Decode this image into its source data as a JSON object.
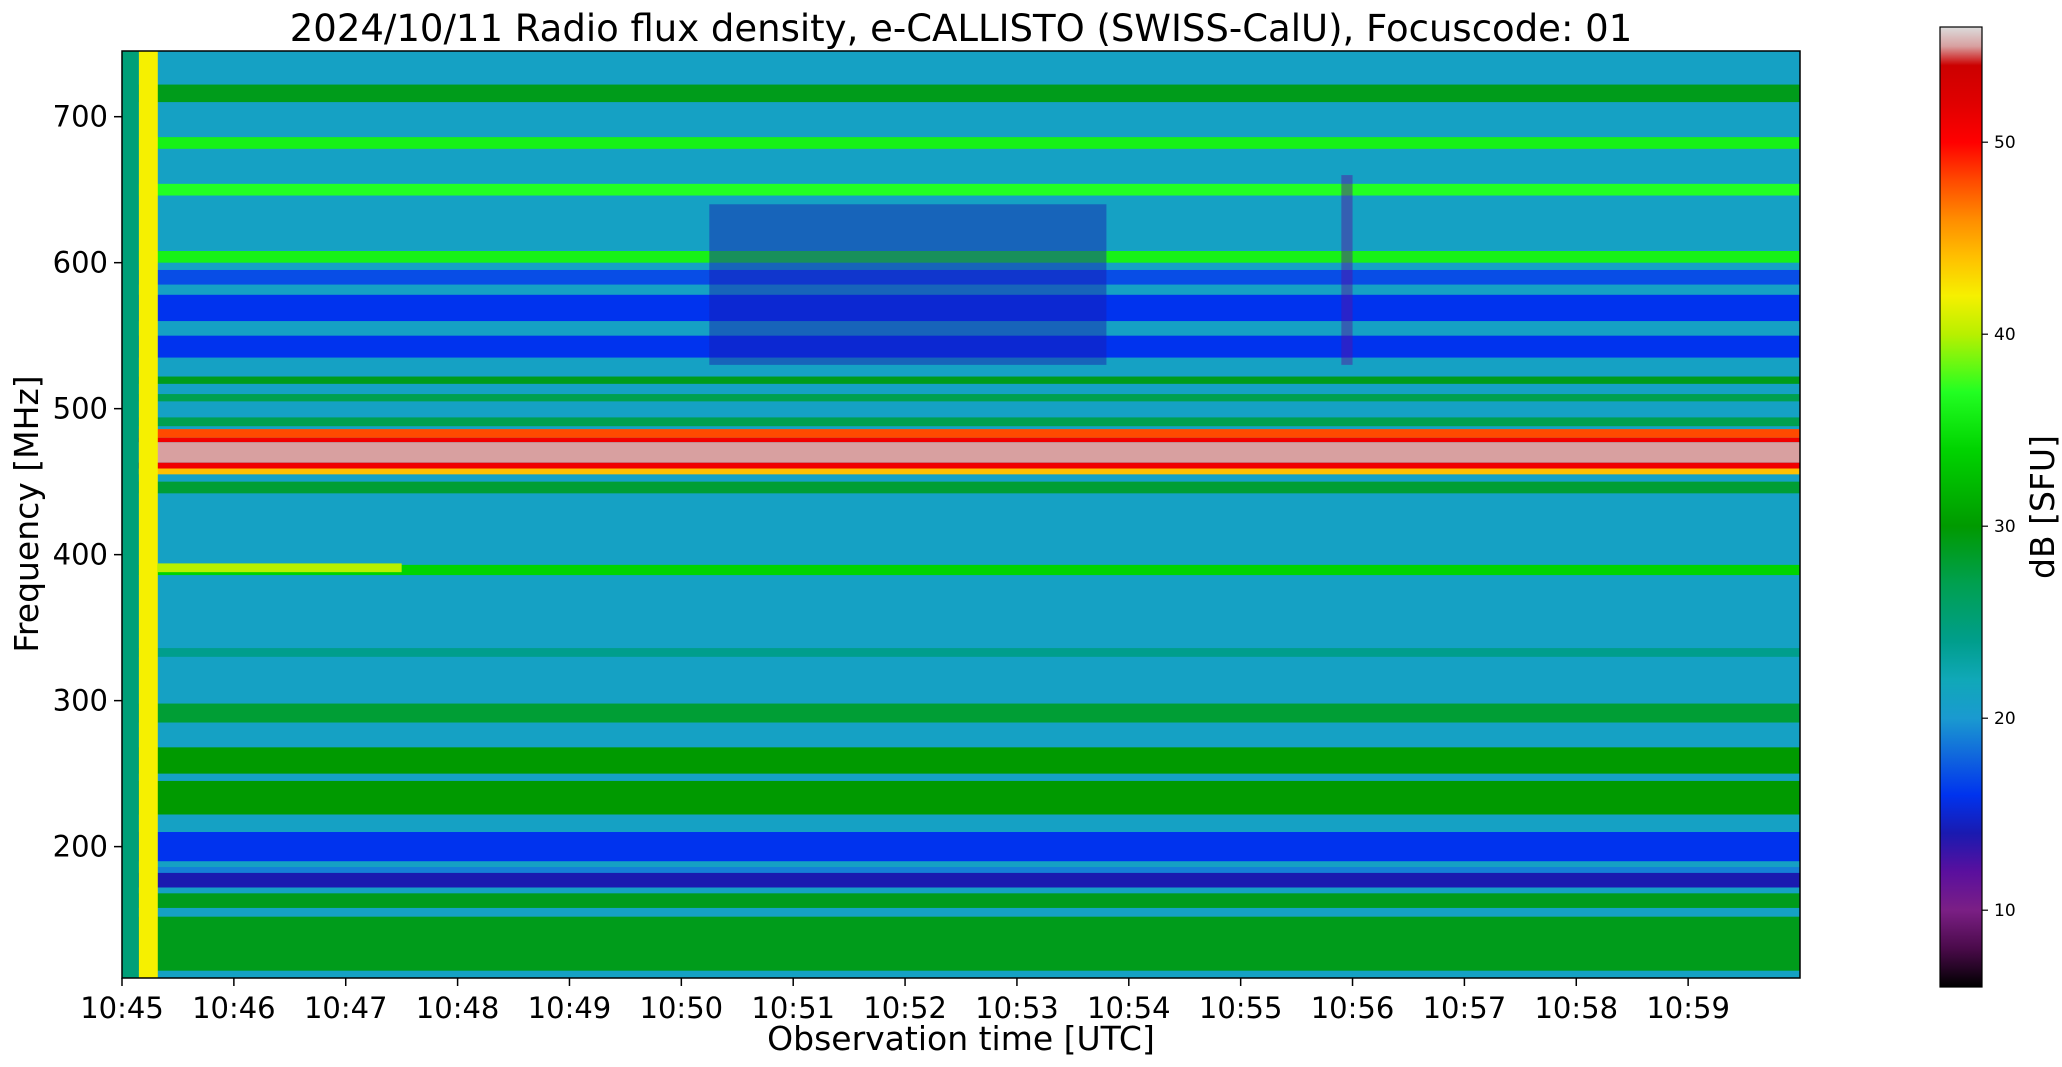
{
  "chart_data": {
    "type": "heatmap",
    "title": "2024/10/11  Radio flux density, e-CALLISTO (SWISS-CalU), Focuscode: 01",
    "xlabel": "Observation time [UTC]",
    "ylabel": "Frequency [MHz]",
    "x_ticks": [
      "10:45",
      "10:46",
      "10:47",
      "10:48",
      "10:49",
      "10:50",
      "10:51",
      "10:52",
      "10:53",
      "10:54",
      "10:55",
      "10:56",
      "10:57",
      "10:58",
      "10:59"
    ],
    "x_range_minutes": [
      0,
      15
    ],
    "y_ticks": [
      200,
      300,
      400,
      500,
      600,
      700
    ],
    "ylim": [
      110,
      745
    ],
    "colorbar": {
      "label": "dB [SFU]",
      "ticks": [
        10,
        20,
        30,
        40,
        50
      ],
      "range": [
        6,
        56
      ],
      "stops": [
        {
          "v": 6,
          "c": "#000000"
        },
        {
          "v": 8,
          "c": "#4a0a4a"
        },
        {
          "v": 10,
          "c": "#7b1f85"
        },
        {
          "v": 12,
          "c": "#5a0f9e"
        },
        {
          "v": 14,
          "c": "#1a1ab0"
        },
        {
          "v": 16,
          "c": "#0033ee"
        },
        {
          "v": 18,
          "c": "#1066dd"
        },
        {
          "v": 20,
          "c": "#1a9ad0"
        },
        {
          "v": 22,
          "c": "#10a8b8"
        },
        {
          "v": 24,
          "c": "#009e8c"
        },
        {
          "v": 27,
          "c": "#00a050"
        },
        {
          "v": 30,
          "c": "#009a00"
        },
        {
          "v": 34,
          "c": "#00d400"
        },
        {
          "v": 37,
          "c": "#22ff22"
        },
        {
          "v": 40,
          "c": "#b8f000"
        },
        {
          "v": 42,
          "c": "#f6f000"
        },
        {
          "v": 44,
          "c": "#ffc000"
        },
        {
          "v": 46,
          "c": "#ff8c00"
        },
        {
          "v": 48,
          "c": "#ff4a00"
        },
        {
          "v": 50,
          "c": "#ff0000"
        },
        {
          "v": 52,
          "c": "#e00000"
        },
        {
          "v": 54,
          "c": "#cc0000"
        },
        {
          "v": 55,
          "c": "#d8a0a0"
        },
        {
          "v": 56,
          "c": "#dcdcdc"
        }
      ]
    },
    "background_db": 21,
    "bands": [
      {
        "f_lo": 710,
        "f_hi": 722,
        "db": 29
      },
      {
        "f_lo": 678,
        "f_hi": 686,
        "db": 36
      },
      {
        "f_lo": 646,
        "f_hi": 654,
        "db": 37
      },
      {
        "f_lo": 600,
        "f_hi": 608,
        "db": 36
      },
      {
        "f_lo": 585,
        "f_hi": 595,
        "db": 17
      },
      {
        "f_lo": 560,
        "f_hi": 578,
        "db": 16
      },
      {
        "f_lo": 535,
        "f_hi": 550,
        "db": 16
      },
      {
        "f_lo": 517,
        "f_hi": 522,
        "db": 29
      },
      {
        "f_lo": 505,
        "f_hi": 510,
        "db": 27
      },
      {
        "f_lo": 488,
        "f_hi": 494,
        "db": 27
      },
      {
        "f_lo": 480,
        "f_hi": 486,
        "db": 48
      },
      {
        "f_lo": 477,
        "f_hi": 480,
        "db": 51
      },
      {
        "f_lo": 463,
        "f_hi": 477,
        "db": 55
      },
      {
        "f_lo": 459,
        "f_hi": 463,
        "db": 51
      },
      {
        "f_lo": 455,
        "f_hi": 459,
        "db": 44
      },
      {
        "f_lo": 442,
        "f_hi": 450,
        "db": 28
      },
      {
        "f_lo": 386,
        "f_hi": 393,
        "db": 34
      },
      {
        "f_lo": 330,
        "f_hi": 336,
        "db": 24
      },
      {
        "f_lo": 285,
        "f_hi": 298,
        "db": 28
      },
      {
        "f_lo": 250,
        "f_hi": 268,
        "db": 30
      },
      {
        "f_lo": 222,
        "f_hi": 245,
        "db": 30
      },
      {
        "f_lo": 190,
        "f_hi": 210,
        "db": 16
      },
      {
        "f_lo": 182,
        "f_hi": 186,
        "db": 19
      },
      {
        "f_lo": 172,
        "f_hi": 182,
        "db": 14
      },
      {
        "f_lo": 158,
        "f_hi": 168,
        "db": 29
      },
      {
        "f_lo": 115,
        "f_hi": 152,
        "db": 29
      }
    ],
    "features": [
      {
        "kind": "column",
        "t_start": 0.15,
        "t_end": 0.32,
        "db": 42,
        "note": "calibration"
      },
      {
        "kind": "column",
        "t_start": 0.0,
        "t_end": 0.15,
        "db": 25
      },
      {
        "kind": "segment",
        "t_start": 0.32,
        "t_end": 2.5,
        "f_lo": 388,
        "f_hi": 394,
        "db": 40
      }
    ],
    "activity": [
      {
        "t_start": 5.25,
        "t_end": 8.8,
        "f_lo": 530,
        "f_hi": 640,
        "db": 14
      },
      {
        "t_start": 10.9,
        "t_end": 11.0,
        "f_lo": 530,
        "f_hi": 660,
        "db": 12
      }
    ]
  }
}
